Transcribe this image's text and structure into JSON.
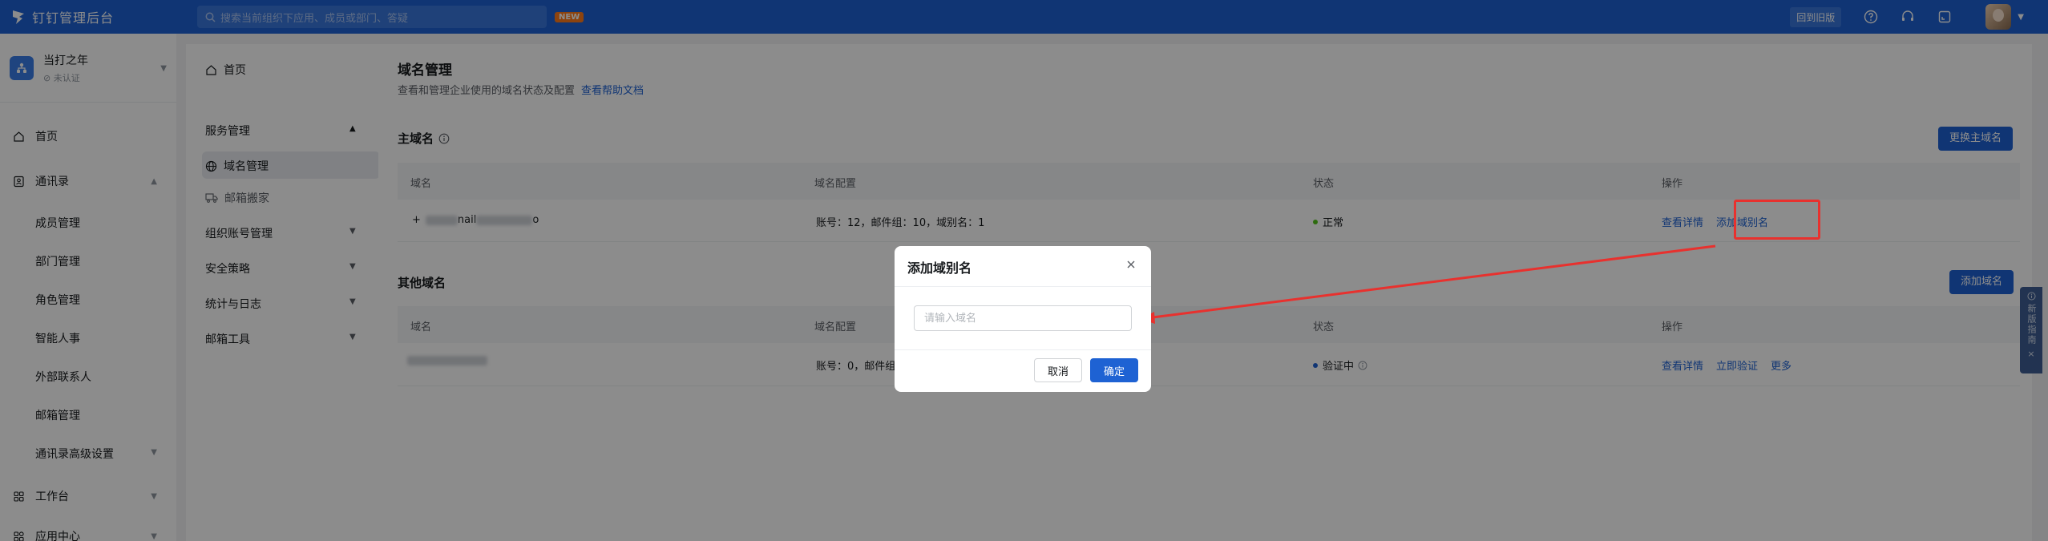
{
  "topbar": {
    "app_title": "钉钉管理后台",
    "search_placeholder": "搜索当前组织下应用、成员或部门、答疑",
    "new_badge": "NEW",
    "old_version_label": "回到旧版"
  },
  "org": {
    "name": "当打之年",
    "status": "未认证"
  },
  "sidebar": {
    "items": [
      {
        "label": "首页"
      },
      {
        "label": "通讯录"
      },
      {
        "label": "成员管理"
      },
      {
        "label": "部门管理"
      },
      {
        "label": "角色管理"
      },
      {
        "label": "智能人事"
      },
      {
        "label": "外部联系人"
      },
      {
        "label": "邮箱管理"
      },
      {
        "label": "通讯录高级设置"
      },
      {
        "label": "工作台"
      },
      {
        "label": "应用中心"
      }
    ]
  },
  "subnav": {
    "home": "首页",
    "group_service": "服务管理",
    "domain_mgmt": "域名管理",
    "mail_move": "邮箱搬家",
    "org_account": "组织账号管理",
    "security": "安全策略",
    "stats_log": "统计与日志",
    "mail_tools": "邮箱工具"
  },
  "main": {
    "title": "域名管理",
    "desc": "查看和管理企业使用的域名状态及配置",
    "help_link": "查看帮助文档",
    "primary_section": {
      "title": "主域名",
      "replace_btn": "更换主域名",
      "headers": [
        "域名",
        "域名配置",
        "状态",
        "操作"
      ],
      "row": {
        "domain_prefix": "+",
        "domain_mid": "nail",
        "domain_suffix": "o",
        "config": "账号：12，邮件组：10，域别名：1",
        "status": "正常",
        "status_color": "#52c41a",
        "action_detail": "查看详情",
        "action_alias": "添加域别名"
      }
    },
    "other_section": {
      "title": "其他域名",
      "add_btn": "添加域名",
      "headers": [
        "域名",
        "域名配置",
        "状态",
        "操作"
      ],
      "row": {
        "config": "账号：0，邮件组",
        "status": "验证中",
        "status_color": "#1e62d3",
        "action_detail": "查看详情",
        "action_verify": "立即验证",
        "action_more": "更多"
      }
    }
  },
  "modal": {
    "title": "添加域别名",
    "input_placeholder": "请输入域名",
    "cancel": "取消",
    "ok": "确定"
  },
  "guide": {
    "label": "新版指南"
  }
}
